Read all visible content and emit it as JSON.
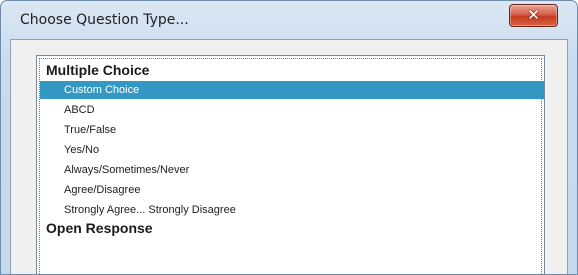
{
  "window": {
    "title": "Choose Question Type...",
    "close_icon": "x-icon"
  },
  "question_types": {
    "groups": [
      {
        "label": "Multiple Choice",
        "items": [
          {
            "label": "Custom Choice",
            "selected": true
          },
          {
            "label": "ABCD",
            "selected": false
          },
          {
            "label": "True/False",
            "selected": false
          },
          {
            "label": "Yes/No",
            "selected": false
          },
          {
            "label": "Always/Sometimes/Never",
            "selected": false
          },
          {
            "label": "Agree/Disagree",
            "selected": false
          },
          {
            "label": "Strongly Agree... Strongly Disagree",
            "selected": false
          }
        ]
      },
      {
        "label": "Open Response",
        "items": []
      }
    ],
    "selection_color": "#3399c4"
  }
}
